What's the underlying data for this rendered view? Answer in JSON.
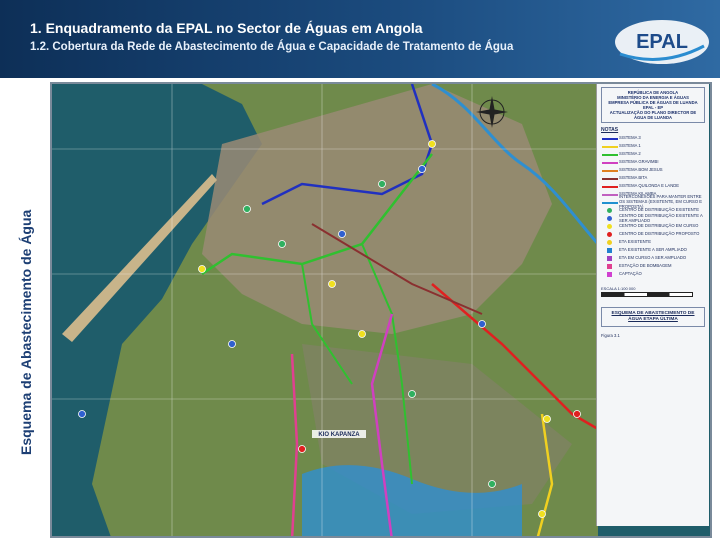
{
  "header": {
    "title": "1. Enquadramento da EPAL no Sector de Águas em Angola",
    "subtitle": "1.2. Cobertura da Rede de Abastecimento de Água e Capacidade de Tratamento de Água",
    "logo_text": "EPAL"
  },
  "side_label": "Esquema de Abastecimento de Água",
  "map": {
    "place_labels": [
      "KIO KAPANZA"
    ],
    "colors": {
      "sea": "#1f5d6a",
      "land": "#6f8a4b",
      "urban": "#9a8a74",
      "water": "#2f8fd0"
    }
  },
  "legend": {
    "authority": [
      "REPÚBLICA DE ANGOLA",
      "MINISTÉRIO DA ENERGIA E ÁGUAS",
      "EMPRESA PÚBLICA DE ÁGUAS DE LUANDA",
      "EPAL - EP",
      "ACTUALIZAÇÃO DO PLANO DIRECTOR DE ÁGUA DE LUANDA"
    ],
    "notes_title": "NOTAS",
    "items": [
      {
        "label": "SISTEMA 3",
        "color": "#2030c0",
        "kind": "line"
      },
      {
        "label": "SISTEMA 1",
        "color": "#f0d020",
        "kind": "line"
      },
      {
        "label": "SISTEMA 2",
        "color": "#30c030",
        "kind": "line"
      },
      {
        "label": "SISTEMA GRAVIMBI",
        "color": "#d040c0",
        "kind": "line"
      },
      {
        "label": "SISTEMA BOM JESUS",
        "color": "#e08020",
        "kind": "line"
      },
      {
        "label": "SISTEMA BITA",
        "color": "#8a3030",
        "kind": "line"
      },
      {
        "label": "SISTEMA QUILONDA E LANDE",
        "color": "#e02020",
        "kind": "line"
      },
      {
        "label": "SISTEMA KILAMBA",
        "color": "#c060c0",
        "kind": "line"
      },
      {
        "label": "INTERCONEXÕES PARA MANTER ENTRE OS SISTEMAS (EXISTENTE, EM CURSO E PROPOSTA)",
        "color": "#2090d0",
        "kind": "line"
      },
      {
        "label": "CENTRO DE DISTRIBUIÇÃO EXISTENTE",
        "color": "#30b060",
        "kind": "dot"
      },
      {
        "label": "CENTRO DE DISTRIBUIÇÃO EXISTENTE A SER AMPLIADO",
        "color": "#3060d0",
        "kind": "dot"
      },
      {
        "label": "CENTRO DE DISTRIBUIÇÃO EM CURSO",
        "color": "#f0e020",
        "kind": "dot"
      },
      {
        "label": "CENTRO DE DISTRIBUIÇÃO PROPOSTO",
        "color": "#e02020",
        "kind": "dot"
      },
      {
        "label": "ETA EXISTENTE",
        "color": "#f0d020",
        "kind": "dot"
      },
      {
        "label": "ETA EXISTENTE A SER AMPLIADO",
        "color": "#2080d0",
        "kind": "sq"
      },
      {
        "label": "ETA EM CURSO A SER AMPLIADO",
        "color": "#a040c0",
        "kind": "sq"
      },
      {
        "label": "ESTAÇÃO DE BOMBAGEM",
        "color": "#e04090",
        "kind": "sq"
      },
      {
        "label": "CAPTAÇÃO",
        "color": "#d040d0",
        "kind": "sq"
      }
    ],
    "scale_label": "ESCALA 1:100 000",
    "map_title": "ESQUEMA DE ABASTECIMENTO DE ÁGUA ETAPA ÚLTIMA",
    "sheet": [
      "Figura 3.1"
    ]
  }
}
